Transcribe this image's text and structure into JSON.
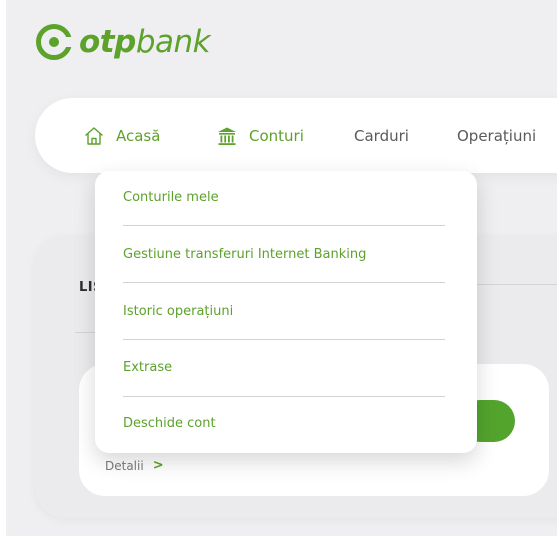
{
  "brand": {
    "bold": "otp",
    "light": "bank",
    "color": "#5ca22b"
  },
  "nav": {
    "items": [
      {
        "label": "Acasă",
        "icon": "home-icon",
        "active": true
      },
      {
        "label": "Conturi",
        "icon": "bank-icon",
        "active": true
      },
      {
        "label": "Carduri",
        "icon": "",
        "active": false
      },
      {
        "label": "Operațiuni",
        "icon": "",
        "active": false
      }
    ]
  },
  "dropdown": {
    "items": [
      {
        "label": "Conturile mele"
      },
      {
        "label": "Gestiune transferuri Internet Banking"
      },
      {
        "label": "Istoric operațiuni"
      },
      {
        "label": "Extrase"
      },
      {
        "label": "Deschide cont"
      }
    ]
  },
  "panel": {
    "title_partial": "LIS",
    "details_label": "Detalii",
    "details_chevron": ">"
  },
  "colors": {
    "accent": "#5ca22b",
    "toggle": "#53a42d",
    "text_muted": "#5a5a5a"
  }
}
